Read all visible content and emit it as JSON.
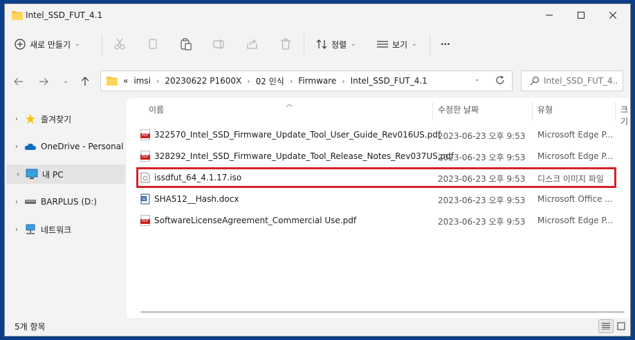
{
  "window": {
    "title": "Intel_SSD_FUT_4.1"
  },
  "toolbar": {
    "new_label": "새로 만들기",
    "sort_label": "정렬",
    "view_label": "보기",
    "more_label": "···"
  },
  "address": {
    "overflow": "«",
    "crumbs": [
      "imsi",
      "20230622 P1600X",
      "02 인식",
      "Firmware",
      "Intel_SSD_FUT_4.1"
    ]
  },
  "search": {
    "placeholder": "Intel_SSD_FUT_4...."
  },
  "nav": {
    "items": [
      {
        "label": "즐겨찾기",
        "icon": "star-icon"
      },
      {
        "label": "OneDrive - Personal",
        "icon": "cloud-icon"
      },
      {
        "label": "내 PC",
        "icon": "computer-icon"
      },
      {
        "label": "BARPLUS (D:)",
        "icon": "drive-icon"
      },
      {
        "label": "네트워크",
        "icon": "network-icon"
      }
    ]
  },
  "columns": {
    "name": "이름",
    "modified": "수정한 날짜",
    "type": "유형",
    "size": "크기"
  },
  "files": [
    {
      "name": "322570_Intel_SSD_Firmware_Update_Tool_User_Guide_Rev016US.pdf",
      "date": "2023-06-23 오후 9:53",
      "type": "Microsoft Edge P...",
      "icon": "pdf-icon"
    },
    {
      "name": "328292_Intel_SSD_Firmware_Update_Tool_Release_Notes_Rev037US.pdf",
      "date": "2023-06-23 오후 9:53",
      "type": "Microsoft Edge P...",
      "icon": "pdf-icon"
    },
    {
      "name": "issdfut_64_4.1.17.iso",
      "date": "2023-06-23 오후 9:53",
      "type": "디스크 이미지 파일",
      "icon": "disc-image-icon"
    },
    {
      "name": "SHA512__Hash.docx",
      "date": "2023-06-23 오후 9:53",
      "type": "Microsoft Office ...",
      "icon": "word-doc-icon"
    },
    {
      "name": "SoftwareLicenseAgreement_Commercial Use.pdf",
      "date": "2023-06-23 오후 9:53",
      "type": "Microsoft Edge P...",
      "icon": "pdf-icon"
    }
  ],
  "status": {
    "count": "5개 항목"
  },
  "colors": {
    "highlight": "#d2232a",
    "accent": "#0067c0"
  }
}
